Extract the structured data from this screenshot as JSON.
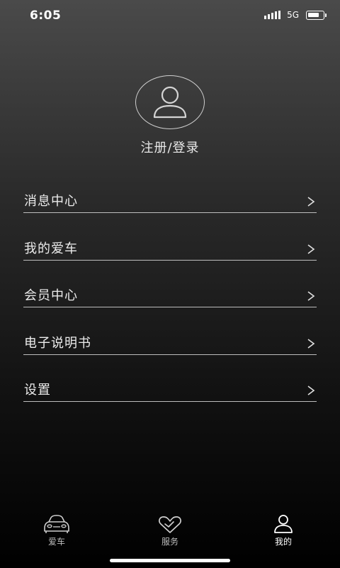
{
  "status_bar": {
    "time": "6:05",
    "network": "5G",
    "battery_level": 0.75
  },
  "profile": {
    "avatar_icon": "user-icon",
    "login_label": "注册/登录"
  },
  "menu": {
    "items": [
      {
        "label": "消息中心",
        "icon": "chevron-right-icon"
      },
      {
        "label": "我的爱车",
        "icon": "chevron-right-icon"
      },
      {
        "label": "会员中心",
        "icon": "chevron-right-icon"
      },
      {
        "label": "电子说明书",
        "icon": "chevron-right-icon"
      },
      {
        "label": "设置",
        "icon": "chevron-right-icon"
      }
    ]
  },
  "tabbar": {
    "tabs": [
      {
        "label": "爱车",
        "icon": "car-icon",
        "active": false
      },
      {
        "label": "服务",
        "icon": "heart-icon",
        "active": false
      },
      {
        "label": "我的",
        "icon": "user-icon",
        "active": true
      }
    ]
  },
  "colors": {
    "background_top": "#4a4a4a",
    "background_bottom": "#000000",
    "text": "#e6e6e6",
    "divider": "#bdbdbd"
  }
}
